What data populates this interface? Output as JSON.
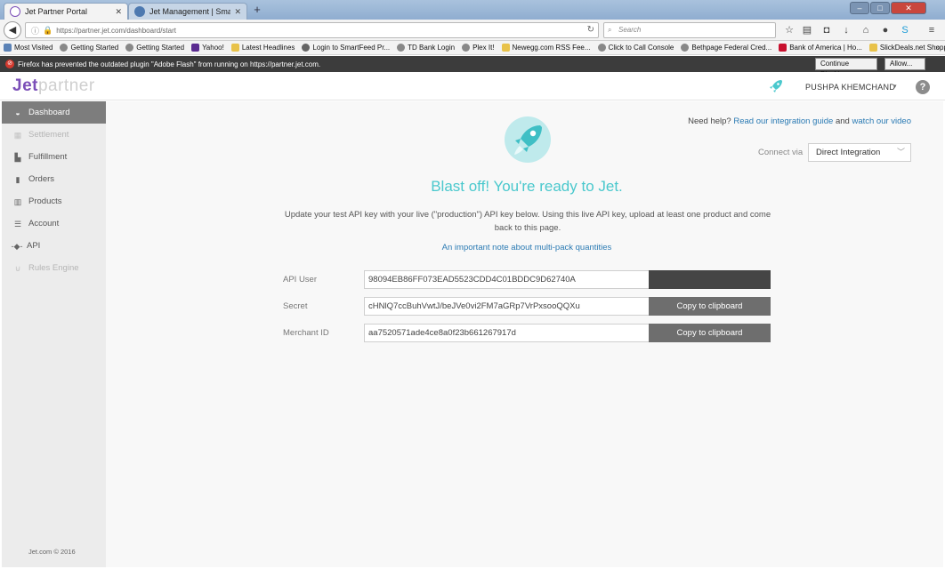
{
  "browser": {
    "tabs": [
      {
        "title": "Jet Partner Portal",
        "active": true
      },
      {
        "title": "Jet Management | SmartFe...",
        "active": false
      }
    ],
    "url": "https://partner.jet.com/dashboard/start",
    "search_placeholder": "Search",
    "bookmarks": [
      "Most Visited",
      "Getting Started",
      "Getting Started",
      "Yahoo!",
      "Latest Headlines",
      "Login to SmartFeed Pr...",
      "TD Bank Login",
      "Plex It!",
      "Newegg.com RSS Fee...",
      "Click to Call Console",
      "Bethpage Federal Cred...",
      "Bank of America | Ho...",
      "SlickDeals.net Shoppin..."
    ],
    "plugin_notice": "Firefox has prevented the outdated plugin \"Adobe Flash\" from running on https://partner.jet.com.",
    "continue_blocking_label": "Continue Blocking",
    "allow_label": "Allow..."
  },
  "header": {
    "logo_jet": "Jet",
    "logo_partner": "partner",
    "user_name": "PUSHPA KHEMCHAND",
    "help_label": "?"
  },
  "sidebar": {
    "items": [
      {
        "label": "Dashboard",
        "icon": "dashboard-icon",
        "state": "active"
      },
      {
        "label": "Settlement",
        "icon": "settlement-icon",
        "state": "disabled"
      },
      {
        "label": "Fulfillment",
        "icon": "fulfillment-icon",
        "state": "normal"
      },
      {
        "label": "Orders",
        "icon": "orders-icon",
        "state": "normal"
      },
      {
        "label": "Products",
        "icon": "products-icon",
        "state": "normal"
      },
      {
        "label": "Account",
        "icon": "account-icon",
        "state": "normal"
      },
      {
        "label": "API",
        "icon": "api-icon",
        "state": "normal"
      },
      {
        "label": "Rules Engine",
        "icon": "rules-engine-icon",
        "state": "disabled"
      }
    ],
    "footer": "Jet.com © 2016"
  },
  "main": {
    "help_prefix": "Need help?",
    "help_link1": "Read our integration guide",
    "help_and": "and",
    "help_link2": "watch our video",
    "connect_via_label": "Connect via",
    "connect_via_value": "Direct Integration",
    "headline": "Blast off! You're ready to Jet.",
    "instructions": "Update your test API key with your live (\"production\") API key below. Using this live API key, upload at least one product and come back to this page.",
    "multipack_link": "An important note about multi-pack quantities",
    "fields": [
      {
        "label": "API User",
        "value": "98094EB86FF073EAD5523CDD4C01BDDC9D62740A",
        "button": ""
      },
      {
        "label": "Secret",
        "value": "cHNlQ7ccBuhVwtJ/beJVe0vi2FM7aGRp7VrPxsooQQXu",
        "button": "Copy to clipboard"
      },
      {
        "label": "Merchant ID",
        "value": "aa7520571ade4ce8a0f23b661267917d",
        "button": "Copy to clipboard"
      }
    ]
  },
  "colors": {
    "accent_teal": "#4ac8cd",
    "brand_purple": "#7b4fb8",
    "link_blue": "#2a7ab3",
    "sidebar_active": "#7d7d7d"
  }
}
